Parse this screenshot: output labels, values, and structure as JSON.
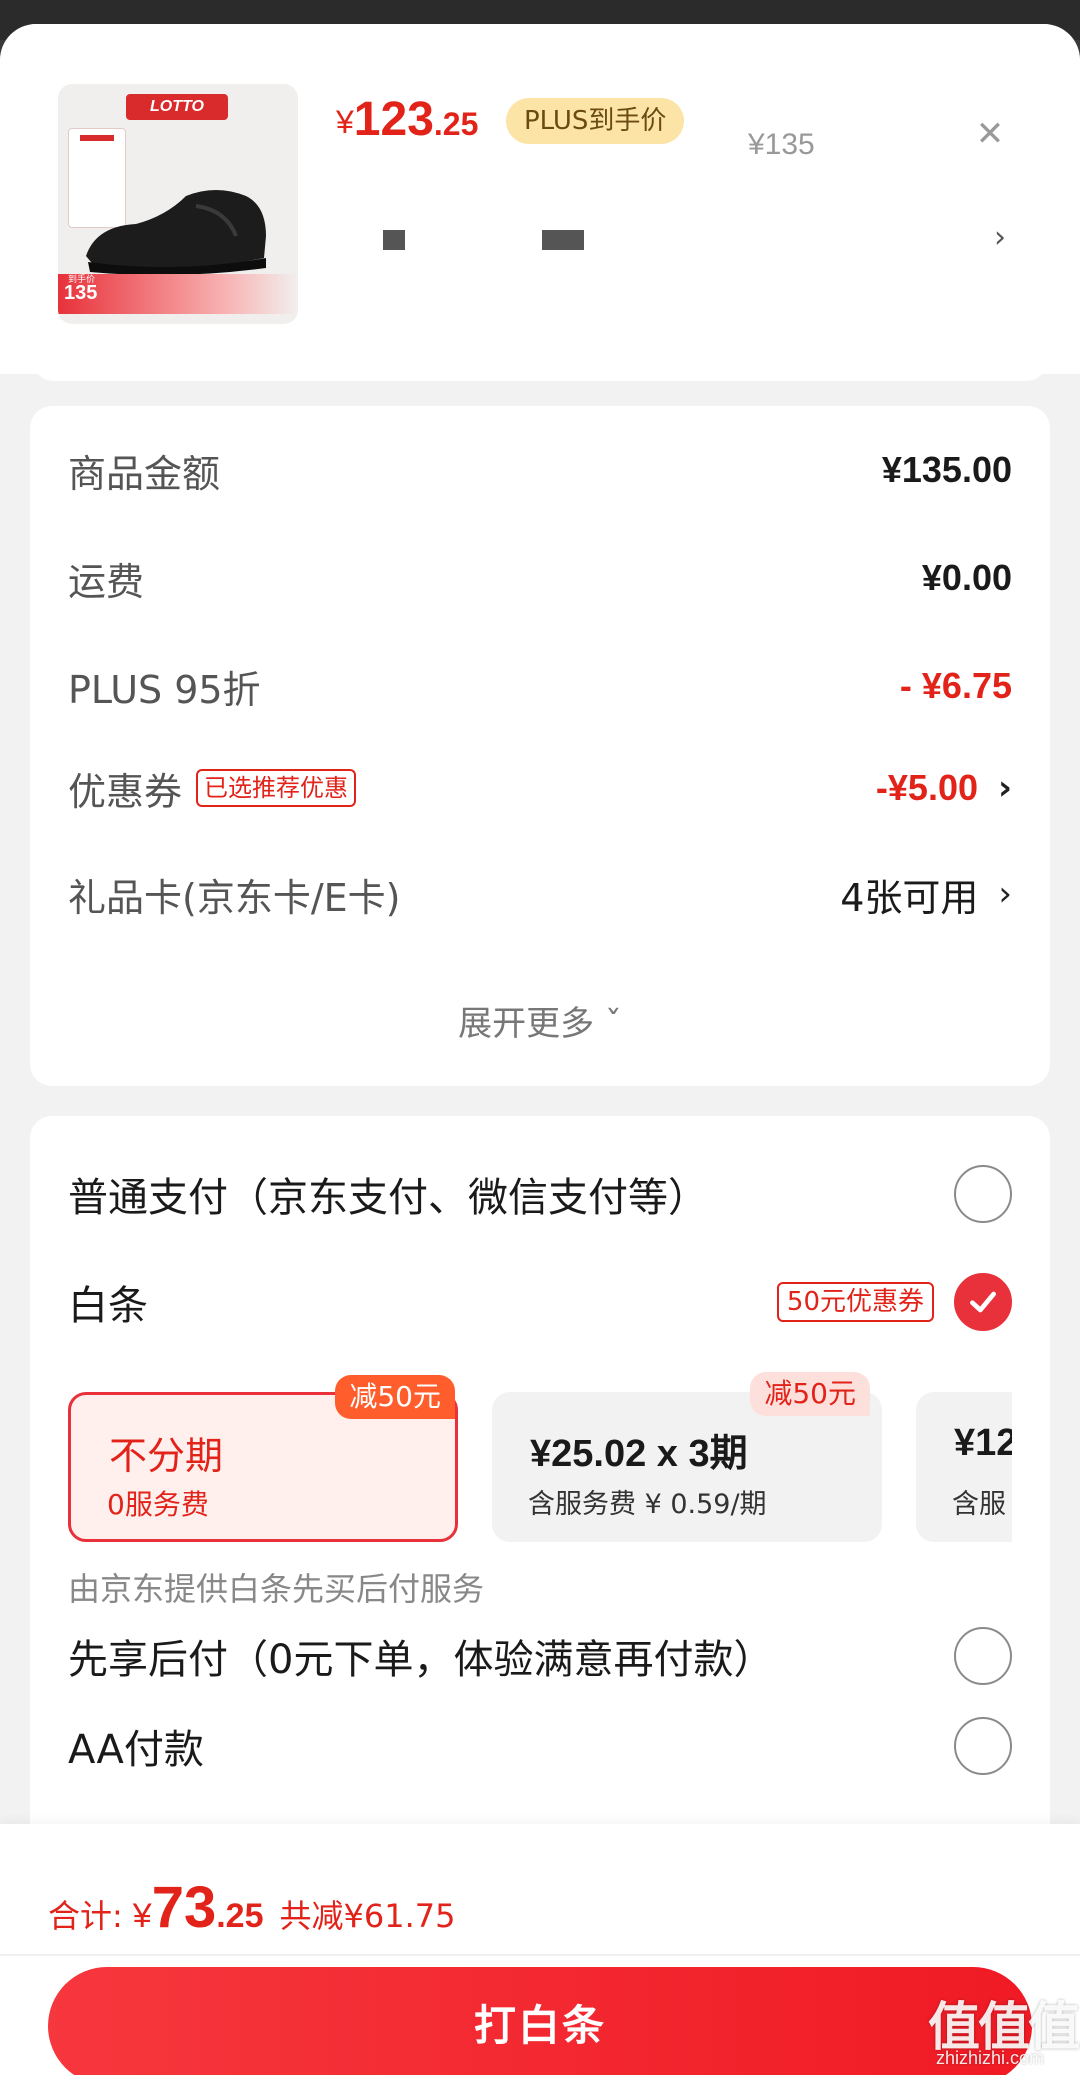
{
  "product": {
    "brand_logo": "LOTTO",
    "thumb_price": "135",
    "thumb_price_label": "到手价",
    "price_currency": "¥",
    "price_int": "123",
    "price_dec": ".25",
    "plus_badge": "PLUS到手价",
    "original_price": "¥135",
    "close_icon": "close-icon",
    "chevron": "›"
  },
  "summary": {
    "rows": [
      {
        "label": "商品金额",
        "value": "¥135.00"
      },
      {
        "label": "运费",
        "value": "¥0.00"
      },
      {
        "label": "PLUS 95折",
        "value": "- ¥6.75"
      },
      {
        "label": "优惠券",
        "tag": "已选推荐优惠",
        "value": "-¥5.00"
      },
      {
        "label": "礼品卡(京东卡/E卡)",
        "value": "4张可用"
      }
    ],
    "expand_more": "展开更多 ˇ"
  },
  "payment": {
    "normal": "普通支付（京东支付、微信支付等）",
    "baitiao": "白条",
    "baitiao_coupon": "50元优惠券",
    "options": [
      {
        "title": "不分期",
        "sub": "0服务费",
        "flag": "减50元",
        "selected": true
      },
      {
        "title": "¥25.02 x 3期",
        "sub": "含服务费 ¥ 0.59/期",
        "flag": "减50元",
        "selected": false
      },
      {
        "title": "¥12",
        "sub": "含服",
        "selected": false
      }
    ],
    "provider_desc": "由京东提供白条先买后付服务",
    "pay_later": "先享后付（0元下单，体验满意再付款）",
    "aa_pay": "AA付款"
  },
  "footer": {
    "total_label": "合计:",
    "currency": "¥",
    "total_int": "73",
    "total_dec": ".25",
    "saved": "共减¥61.75",
    "pay_button": "打白条"
  },
  "watermark": {
    "main": "值值值",
    "sub": "zhizhizhi.com"
  },
  "colors": {
    "accent": "#e2231a",
    "plus_gold": "#fbe4a6",
    "button": "#f01a24"
  }
}
